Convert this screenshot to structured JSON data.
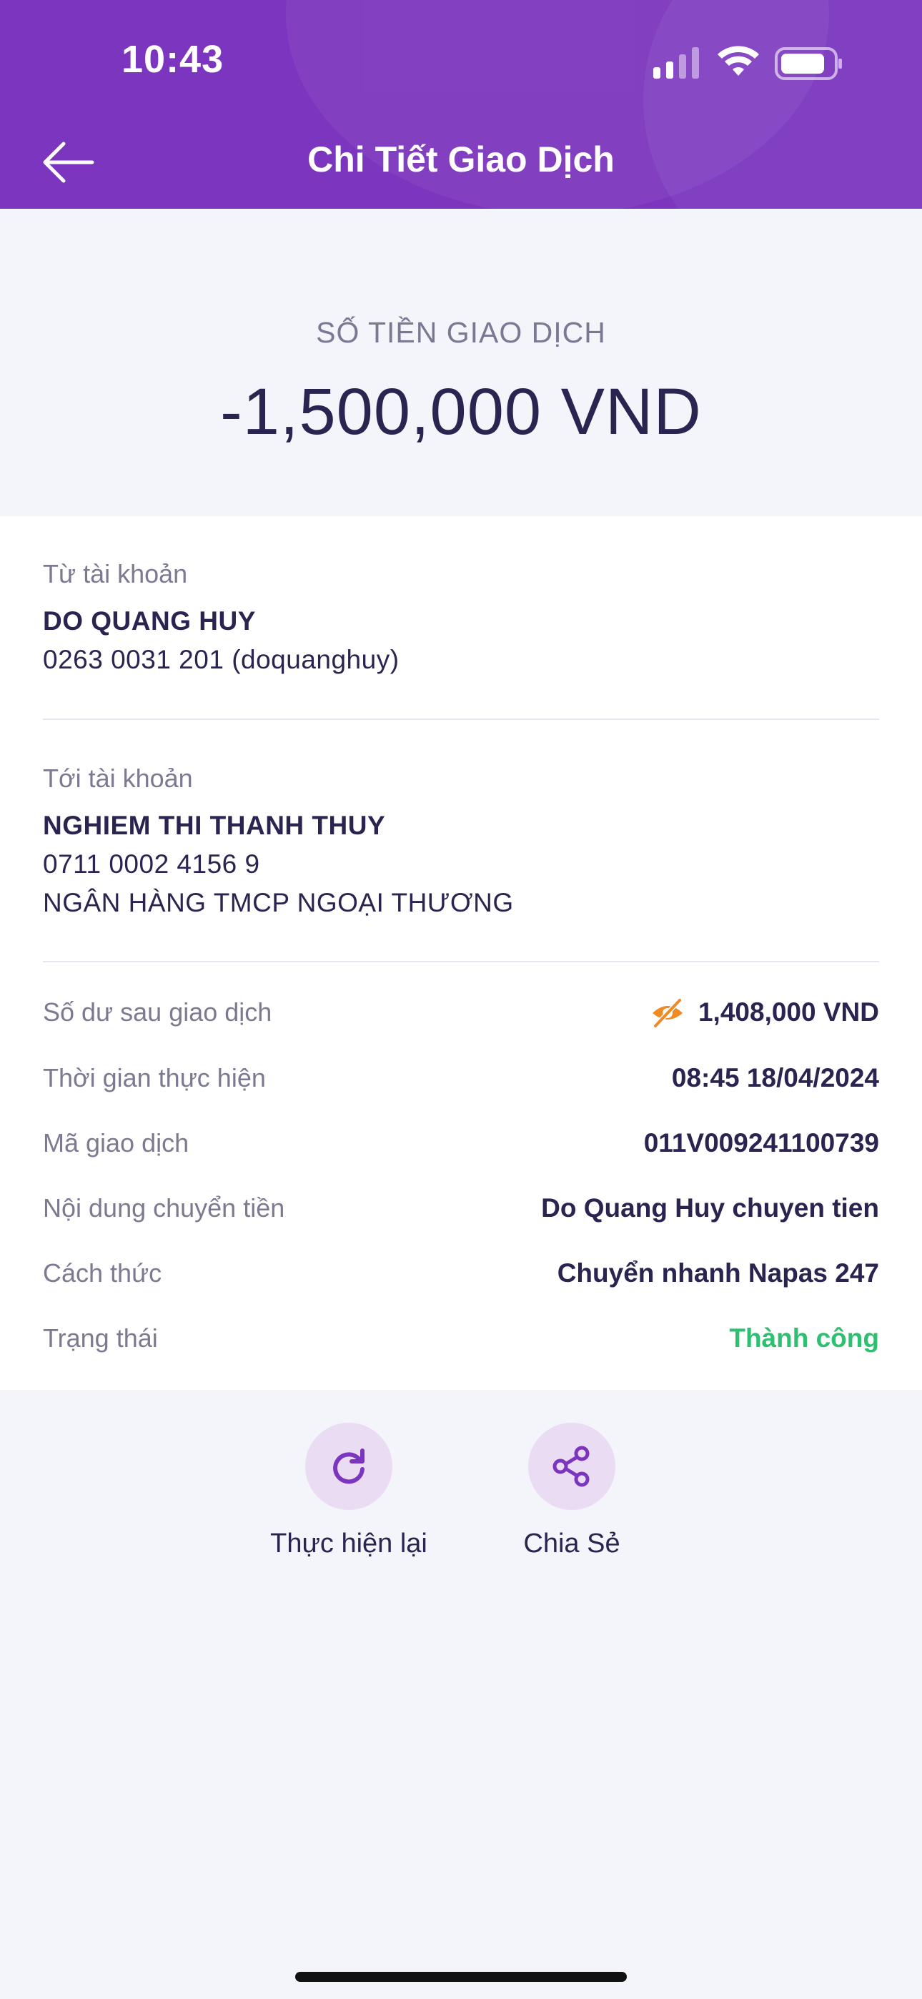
{
  "status_bar": {
    "time": "10:43"
  },
  "header": {
    "title": "Chi Tiết Giao Dịch"
  },
  "amount": {
    "label": "SỐ TIỀN GIAO DỊCH",
    "value": "-1,500,000 VND"
  },
  "from": {
    "label": "Từ tài khoản",
    "name": "DO QUANG HUY",
    "account": "0263 0031 201 (doquanghuy)"
  },
  "to": {
    "label": "Tới tài khoản",
    "name": "NGHIEM THI THANH THUY",
    "account": "0711 0002 4156 9",
    "bank": "NGÂN HÀNG TMCP NGOẠI THƯƠNG"
  },
  "details": [
    {
      "key": "Số dư sau giao dịch",
      "value": "1,408,000 VND"
    },
    {
      "key": "Thời gian thực hiện",
      "value": "08:45 18/04/2024"
    },
    {
      "key": "Mã giao dịch",
      "value": "011V009241100739"
    },
    {
      "key": "Nội dung chuyển tiền",
      "value": "Do Quang Huy chuyen tien"
    },
    {
      "key": "Cách thức",
      "value": "Chuyển nhanh Napas 247"
    },
    {
      "key": "Trạng thái",
      "value": "Thành công"
    }
  ],
  "actions": {
    "redo_label": "Thực hiện lại",
    "share_label": "Chia Sẻ"
  },
  "icons": {
    "back": "arrow-left-icon",
    "visibility": "eye-off-icon",
    "redo": "refresh-icon",
    "share": "share-icon"
  },
  "colors": {
    "header_bg": "#7b35be",
    "accent": "#7b35be",
    "success": "#2fbf71",
    "eye_icon": "#f08a24"
  }
}
